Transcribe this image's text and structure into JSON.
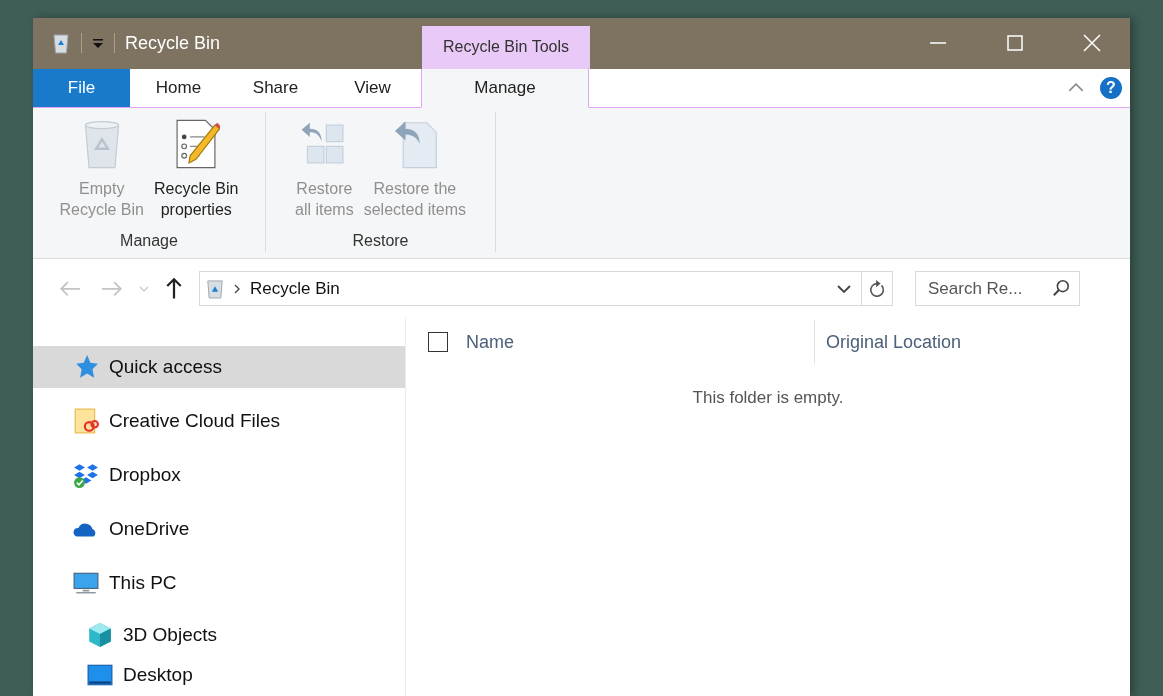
{
  "window": {
    "title": "Recycle Bin",
    "contextual_tab": "Recycle Bin Tools"
  },
  "help": {
    "label": "?"
  },
  "tabs": [
    {
      "label": "File",
      "kind": "file",
      "selected": false
    },
    {
      "label": "Home",
      "kind": "tab",
      "selected": false
    },
    {
      "label": "Share",
      "kind": "tab",
      "selected": false
    },
    {
      "label": "View",
      "kind": "tab",
      "selected": false
    },
    {
      "label": "Manage",
      "kind": "contextual",
      "selected": true
    }
  ],
  "ribbon_groups": [
    {
      "label": "Manage",
      "buttons": [
        {
          "label": "Empty\nRecycle Bin",
          "kind": "empty-bin",
          "disabled": true
        },
        {
          "label": "Recycle Bin\nproperties",
          "kind": "properties",
          "disabled": false
        }
      ]
    },
    {
      "label": "Restore",
      "buttons": [
        {
          "label": "Restore\nall items",
          "kind": "restore-all",
          "disabled": true
        },
        {
          "label": "Restore the\nselected items",
          "kind": "restore-selected",
          "disabled": true
        }
      ]
    }
  ],
  "navigation": {
    "back_disabled": true,
    "forward_disabled": true,
    "up_disabled": false
  },
  "address": {
    "path": "Recycle Bin"
  },
  "search": {
    "placeholder": "Search Re..."
  },
  "sidebar": {
    "items": [
      {
        "label": "Quick access",
        "kind": "quick-access",
        "selected": true
      },
      {
        "label": "Creative Cloud Files",
        "kind": "cloud-files",
        "selected": false
      },
      {
        "label": "Dropbox",
        "kind": "dropbox",
        "selected": false
      },
      {
        "label": "OneDrive",
        "kind": "onedrive",
        "selected": false
      },
      {
        "label": "This PC",
        "kind": "pc",
        "selected": false,
        "children": [
          {
            "label": "3D Objects",
            "kind": "cube",
            "selected": false
          },
          {
            "label": "Desktop",
            "kind": "desktop",
            "selected": false
          }
        ]
      }
    ]
  },
  "file_list": {
    "select_all_checked": false,
    "columns": [
      "Name",
      "Original Location"
    ],
    "empty_message": "This folder is empty."
  }
}
